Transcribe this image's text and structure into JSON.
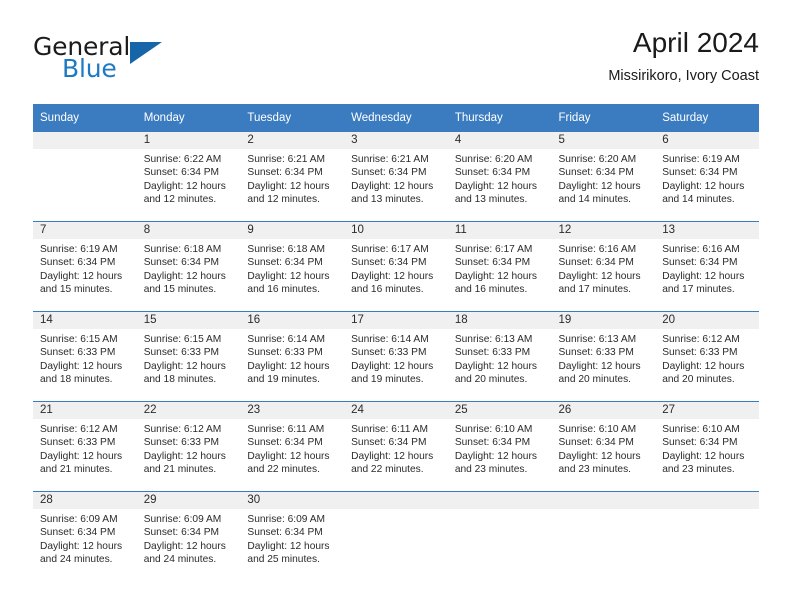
{
  "brand": {
    "name_part1": "General",
    "name_part2": "Blue",
    "logo_icon": "triangle-logo-icon"
  },
  "header": {
    "title": "April 2024",
    "subtitle": "Missirikoro, Ivory Coast"
  },
  "colors": {
    "header_blue": "#3b7cc0",
    "brand_blue": "#1f7ac4",
    "logo_blue": "#1565a8",
    "daynum_band": "#f0f0f0",
    "text": "#2b2b2b"
  },
  "weekday_headers": [
    "Sunday",
    "Monday",
    "Tuesday",
    "Wednesday",
    "Thursday",
    "Friday",
    "Saturday"
  ],
  "weeks": [
    [
      {
        "day": "",
        "sunrise": "",
        "sunset": "",
        "daylight1": "",
        "daylight2": "",
        "blank": true
      },
      {
        "day": "1",
        "sunrise": "Sunrise: 6:22 AM",
        "sunset": "Sunset: 6:34 PM",
        "daylight1": "Daylight: 12 hours",
        "daylight2": "and 12 minutes."
      },
      {
        "day": "2",
        "sunrise": "Sunrise: 6:21 AM",
        "sunset": "Sunset: 6:34 PM",
        "daylight1": "Daylight: 12 hours",
        "daylight2": "and 12 minutes."
      },
      {
        "day": "3",
        "sunrise": "Sunrise: 6:21 AM",
        "sunset": "Sunset: 6:34 PM",
        "daylight1": "Daylight: 12 hours",
        "daylight2": "and 13 minutes."
      },
      {
        "day": "4",
        "sunrise": "Sunrise: 6:20 AM",
        "sunset": "Sunset: 6:34 PM",
        "daylight1": "Daylight: 12 hours",
        "daylight2": "and 13 minutes."
      },
      {
        "day": "5",
        "sunrise": "Sunrise: 6:20 AM",
        "sunset": "Sunset: 6:34 PM",
        "daylight1": "Daylight: 12 hours",
        "daylight2": "and 14 minutes."
      },
      {
        "day": "6",
        "sunrise": "Sunrise: 6:19 AM",
        "sunset": "Sunset: 6:34 PM",
        "daylight1": "Daylight: 12 hours",
        "daylight2": "and 14 minutes."
      }
    ],
    [
      {
        "day": "7",
        "sunrise": "Sunrise: 6:19 AM",
        "sunset": "Sunset: 6:34 PM",
        "daylight1": "Daylight: 12 hours",
        "daylight2": "and 15 minutes."
      },
      {
        "day": "8",
        "sunrise": "Sunrise: 6:18 AM",
        "sunset": "Sunset: 6:34 PM",
        "daylight1": "Daylight: 12 hours",
        "daylight2": "and 15 minutes."
      },
      {
        "day": "9",
        "sunrise": "Sunrise: 6:18 AM",
        "sunset": "Sunset: 6:34 PM",
        "daylight1": "Daylight: 12 hours",
        "daylight2": "and 16 minutes."
      },
      {
        "day": "10",
        "sunrise": "Sunrise: 6:17 AM",
        "sunset": "Sunset: 6:34 PM",
        "daylight1": "Daylight: 12 hours",
        "daylight2": "and 16 minutes."
      },
      {
        "day": "11",
        "sunrise": "Sunrise: 6:17 AM",
        "sunset": "Sunset: 6:34 PM",
        "daylight1": "Daylight: 12 hours",
        "daylight2": "and 16 minutes."
      },
      {
        "day": "12",
        "sunrise": "Sunrise: 6:16 AM",
        "sunset": "Sunset: 6:34 PM",
        "daylight1": "Daylight: 12 hours",
        "daylight2": "and 17 minutes."
      },
      {
        "day": "13",
        "sunrise": "Sunrise: 6:16 AM",
        "sunset": "Sunset: 6:34 PM",
        "daylight1": "Daylight: 12 hours",
        "daylight2": "and 17 minutes."
      }
    ],
    [
      {
        "day": "14",
        "sunrise": "Sunrise: 6:15 AM",
        "sunset": "Sunset: 6:33 PM",
        "daylight1": "Daylight: 12 hours",
        "daylight2": "and 18 minutes."
      },
      {
        "day": "15",
        "sunrise": "Sunrise: 6:15 AM",
        "sunset": "Sunset: 6:33 PM",
        "daylight1": "Daylight: 12 hours",
        "daylight2": "and 18 minutes."
      },
      {
        "day": "16",
        "sunrise": "Sunrise: 6:14 AM",
        "sunset": "Sunset: 6:33 PM",
        "daylight1": "Daylight: 12 hours",
        "daylight2": "and 19 minutes."
      },
      {
        "day": "17",
        "sunrise": "Sunrise: 6:14 AM",
        "sunset": "Sunset: 6:33 PM",
        "daylight1": "Daylight: 12 hours",
        "daylight2": "and 19 minutes."
      },
      {
        "day": "18",
        "sunrise": "Sunrise: 6:13 AM",
        "sunset": "Sunset: 6:33 PM",
        "daylight1": "Daylight: 12 hours",
        "daylight2": "and 20 minutes."
      },
      {
        "day": "19",
        "sunrise": "Sunrise: 6:13 AM",
        "sunset": "Sunset: 6:33 PM",
        "daylight1": "Daylight: 12 hours",
        "daylight2": "and 20 minutes."
      },
      {
        "day": "20",
        "sunrise": "Sunrise: 6:12 AM",
        "sunset": "Sunset: 6:33 PM",
        "daylight1": "Daylight: 12 hours",
        "daylight2": "and 20 minutes."
      }
    ],
    [
      {
        "day": "21",
        "sunrise": "Sunrise: 6:12 AM",
        "sunset": "Sunset: 6:33 PM",
        "daylight1": "Daylight: 12 hours",
        "daylight2": "and 21 minutes."
      },
      {
        "day": "22",
        "sunrise": "Sunrise: 6:12 AM",
        "sunset": "Sunset: 6:33 PM",
        "daylight1": "Daylight: 12 hours",
        "daylight2": "and 21 minutes."
      },
      {
        "day": "23",
        "sunrise": "Sunrise: 6:11 AM",
        "sunset": "Sunset: 6:34 PM",
        "daylight1": "Daylight: 12 hours",
        "daylight2": "and 22 minutes."
      },
      {
        "day": "24",
        "sunrise": "Sunrise: 6:11 AM",
        "sunset": "Sunset: 6:34 PM",
        "daylight1": "Daylight: 12 hours",
        "daylight2": "and 22 minutes."
      },
      {
        "day": "25",
        "sunrise": "Sunrise: 6:10 AM",
        "sunset": "Sunset: 6:34 PM",
        "daylight1": "Daylight: 12 hours",
        "daylight2": "and 23 minutes."
      },
      {
        "day": "26",
        "sunrise": "Sunrise: 6:10 AM",
        "sunset": "Sunset: 6:34 PM",
        "daylight1": "Daylight: 12 hours",
        "daylight2": "and 23 minutes."
      },
      {
        "day": "27",
        "sunrise": "Sunrise: 6:10 AM",
        "sunset": "Sunset: 6:34 PM",
        "daylight1": "Daylight: 12 hours",
        "daylight2": "and 23 minutes."
      }
    ],
    [
      {
        "day": "28",
        "sunrise": "Sunrise: 6:09 AM",
        "sunset": "Sunset: 6:34 PM",
        "daylight1": "Daylight: 12 hours",
        "daylight2": "and 24 minutes."
      },
      {
        "day": "29",
        "sunrise": "Sunrise: 6:09 AM",
        "sunset": "Sunset: 6:34 PM",
        "daylight1": "Daylight: 12 hours",
        "daylight2": "and 24 minutes."
      },
      {
        "day": "30",
        "sunrise": "Sunrise: 6:09 AM",
        "sunset": "Sunset: 6:34 PM",
        "daylight1": "Daylight: 12 hours",
        "daylight2": "and 25 minutes."
      },
      {
        "day": "",
        "sunrise": "",
        "sunset": "",
        "daylight1": "",
        "daylight2": "",
        "blank": true
      },
      {
        "day": "",
        "sunrise": "",
        "sunset": "",
        "daylight1": "",
        "daylight2": "",
        "blank": true
      },
      {
        "day": "",
        "sunrise": "",
        "sunset": "",
        "daylight1": "",
        "daylight2": "",
        "blank": true
      },
      {
        "day": "",
        "sunrise": "",
        "sunset": "",
        "daylight1": "",
        "daylight2": "",
        "blank": true
      }
    ]
  ]
}
